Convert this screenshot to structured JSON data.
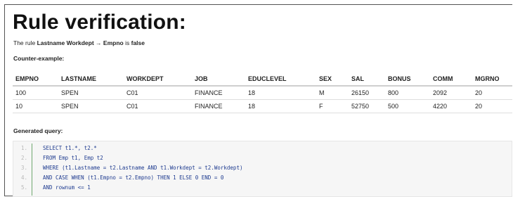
{
  "page": {
    "title": "Rule verification:",
    "rule_prefix": "The rule",
    "rule_lhs": "Lastname Workdept",
    "arrow": "→",
    "rule_rhs": "Empno",
    "rule_is": "is",
    "rule_result": "false",
    "counter_label": "Counter-example:",
    "query_label": "Generated query:"
  },
  "table": {
    "columns": [
      "EMPNO",
      "LASTNAME",
      "WORKDEPT",
      "JOB",
      "EDUCLEVEL",
      "SEX",
      "SAL",
      "BONUS",
      "COMM",
      "MGRNO"
    ],
    "rows": [
      [
        "100",
        "SPEN",
        "C01",
        "FINANCE",
        "18",
        "M",
        "26150",
        "800",
        "2092",
        "20"
      ],
      [
        "10",
        "SPEN",
        "C01",
        "FINANCE",
        "18",
        "F",
        "52750",
        "500",
        "4220",
        "20"
      ]
    ]
  },
  "query": {
    "line_numbers": [
      "1.",
      "2.",
      "3.",
      "4.",
      "5."
    ],
    "lines": [
      "SELECT t1.*, t2.*",
      "FROM Emp t1, Emp t2",
      "WHERE (t1.Lastname = t2.Lastname AND t1.Workdept = t2.Workdept)",
      "AND CASE WHEN (t1.Empno = t2.Empno) THEN 1 ELSE 0 END = 0",
      "AND rownum <= 1"
    ]
  },
  "colors": {
    "code_background": "#f6f6f6",
    "code_text": "#1d3a8f",
    "gutter_rule": "#6ea86e"
  }
}
